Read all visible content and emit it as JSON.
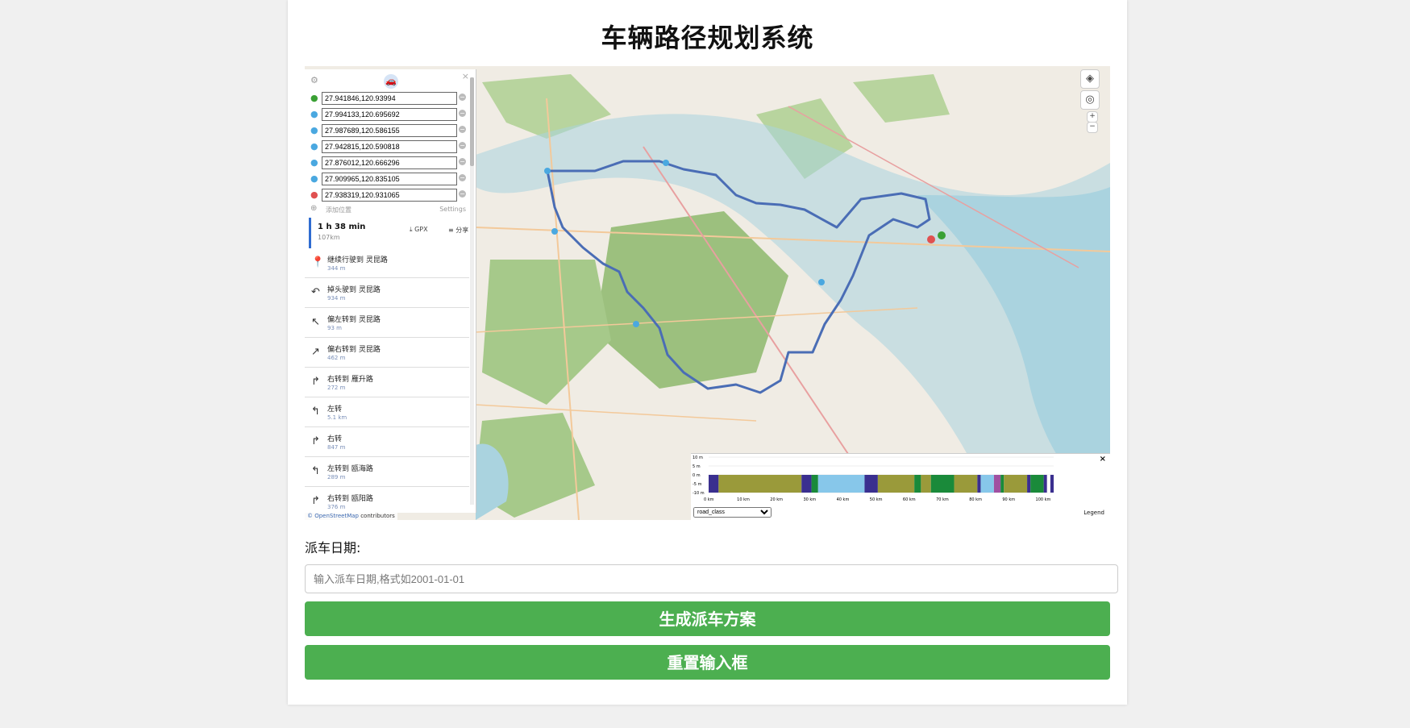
{
  "page": {
    "title": "车辆路径规划系统"
  },
  "router": {
    "waypoints": [
      {
        "value": "27.941846,120.93994",
        "color": "#3aa034"
      },
      {
        "value": "27.994133,120.695692",
        "color": "#4aa8e0"
      },
      {
        "value": "27.987689,120.586155",
        "color": "#4aa8e0"
      },
      {
        "value": "27.942815,120.590818",
        "color": "#4aa8e0"
      },
      {
        "value": "27.876012,120.666296",
        "color": "#4aa8e0"
      },
      {
        "value": "27.909965,120.835105",
        "color": "#4aa8e0"
      },
      {
        "value": "27.938319,120.931065",
        "color": "#e05050"
      }
    ],
    "add_label": "添加位置",
    "settings_label": "Settings",
    "summary": {
      "time": "1 h 38 min",
      "distance": "107km",
      "gpx_label": "GPX",
      "share_label": "分享"
    },
    "instructions": [
      {
        "icon": "continue-icon",
        "glyph": "📍",
        "text": "继续行驶到 灵昆路",
        "dist": "344 m"
      },
      {
        "icon": "u-turn-icon",
        "glyph": "↶",
        "text": "掉头驶到 灵昆路",
        "dist": "934 m"
      },
      {
        "icon": "slight-left-icon",
        "glyph": "↖",
        "text": "偏左转到 灵昆路",
        "dist": "93 m"
      },
      {
        "icon": "slight-right-icon",
        "glyph": "↗",
        "text": "偏右转到 灵昆路",
        "dist": "462 m"
      },
      {
        "icon": "turn-right-icon",
        "glyph": "↱",
        "text": "右转到 雁升路",
        "dist": "272 m"
      },
      {
        "icon": "turn-left-icon",
        "glyph": "↰",
        "text": "左转",
        "dist": "5.1 km"
      },
      {
        "icon": "turn-right-icon",
        "glyph": "↱",
        "text": "右转",
        "dist": "847 m"
      },
      {
        "icon": "turn-left-icon",
        "glyph": "↰",
        "text": "左转到 瓯海路",
        "dist": "289 m"
      },
      {
        "icon": "turn-right-icon",
        "glyph": "↱",
        "text": "右转到 瓯阳路",
        "dist": "376 m"
      }
    ]
  },
  "map": {
    "zoom_in": "+",
    "zoom_out": "−",
    "attribution_link": "© OpenStreetMap",
    "attribution_text": " contributors",
    "route_color": "#4a6db5",
    "water_color": "#aad3df",
    "green_color": "#9cc07e"
  },
  "elevation": {
    "close": "×",
    "select_value": "road_class",
    "legend": "Legend",
    "y_ticks": [
      "10 m",
      "5 m",
      "0 m",
      "-5 m",
      "-10 m"
    ],
    "x_ticks": [
      "0 km",
      "10 km",
      "20 km",
      "30 km",
      "40 km",
      "50 km",
      "60 km",
      "70 km",
      "80 km",
      "90 km",
      "100 km"
    ],
    "segments": [
      {
        "from": 0,
        "to": 3,
        "color": "#3a2f8f"
      },
      {
        "from": 3,
        "to": 28,
        "color": "#9a9a3a"
      },
      {
        "from": 28,
        "to": 31,
        "color": "#3a2f8f"
      },
      {
        "from": 31,
        "to": 33,
        "color": "#1a8a3a"
      },
      {
        "from": 33,
        "to": 47,
        "color": "#87c7ea"
      },
      {
        "from": 47,
        "to": 51,
        "color": "#3a2f8f"
      },
      {
        "from": 51,
        "to": 52,
        "color": "#9a9a3a"
      },
      {
        "from": 52,
        "to": 62,
        "color": "#9a9a3a"
      },
      {
        "from": 62,
        "to": 64,
        "color": "#1a8a3a"
      },
      {
        "from": 64,
        "to": 67,
        "color": "#9a9a3a"
      },
      {
        "from": 67,
        "to": 74,
        "color": "#1a8a3a"
      },
      {
        "from": 74,
        "to": 81,
        "color": "#9a9a3a"
      },
      {
        "from": 81,
        "to": 82,
        "color": "#3a2f8f"
      },
      {
        "from": 82,
        "to": 86,
        "color": "#87c7ea"
      },
      {
        "from": 86,
        "to": 88,
        "color": "#a050a0"
      },
      {
        "from": 88,
        "to": 89,
        "color": "#1a8a3a"
      },
      {
        "from": 89,
        "to": 96,
        "color": "#9a9a3a"
      },
      {
        "from": 96,
        "to": 97,
        "color": "#3a2f8f"
      },
      {
        "from": 97,
        "to": 101,
        "color": "#1a8a3a"
      },
      {
        "from": 101,
        "to": 102,
        "color": "#3a2f8f"
      },
      {
        "from": 102,
        "to": 103,
        "color": "#fff"
      },
      {
        "from": 103,
        "to": 104,
        "color": "#3a2f8f"
      }
    ]
  },
  "form": {
    "date_label": "派车日期:",
    "date_placeholder": "输入派车日期,格式如2001-01-01",
    "generate_label": "生成派车方案",
    "reset_label": "重置输入框"
  }
}
